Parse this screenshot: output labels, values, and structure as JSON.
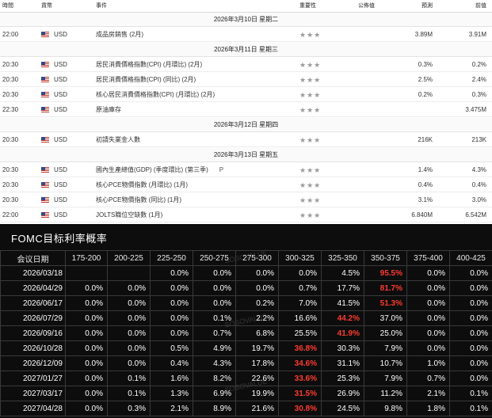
{
  "calendar": {
    "headers": {
      "time": "時間",
      "currency": "貨幣",
      "event": "事件",
      "importance": "重要性",
      "actual": "公佈值",
      "forecast": "預測",
      "previous": "前值"
    },
    "days": [
      {
        "date": "2026年3月10日 星期二",
        "events": [
          {
            "time": "22:00",
            "currency": "USD",
            "event": "成品房銷售 (2月)",
            "stars": "★★★",
            "actual": "",
            "forecast": "3.89M",
            "previous": "3.91M"
          }
        ]
      },
      {
        "date": "2026年3月11日 星期三",
        "events": [
          {
            "time": "20:30",
            "currency": "USD",
            "event": "居民消費價格指數(CPI) (月環比) (2月)",
            "stars": "★★★",
            "actual": "",
            "forecast": "0.3%",
            "previous": "0.2%"
          },
          {
            "time": "20:30",
            "currency": "USD",
            "event": "居民消費價格指數(CPI) (同比) (2月)",
            "stars": "★★★",
            "actual": "",
            "forecast": "2.5%",
            "previous": "2.4%"
          },
          {
            "time": "20:30",
            "currency": "USD",
            "event": "核心居民消費價格指數(CPI) (月環比) (2月)",
            "stars": "★★★",
            "actual": "",
            "forecast": "0.2%",
            "previous": "0.3%"
          },
          {
            "time": "22:30",
            "currency": "USD",
            "event": "原油庫存",
            "stars": "★★★",
            "actual": "",
            "forecast": "",
            "previous": "3.475M"
          }
        ]
      },
      {
        "date": "2026年3月12日 星期四",
        "events": [
          {
            "time": "20:30",
            "currency": "USD",
            "event": "初請失業金人數",
            "stars": "★★★",
            "actual": "",
            "forecast": "216K",
            "previous": "213K"
          }
        ]
      },
      {
        "date": "2026年3月13日 星期五",
        "events": [
          {
            "time": "20:30",
            "currency": "USD",
            "event": "國內生產總值(GDP) (季度環比) (第三季)",
            "extra": "P",
            "stars": "★★★",
            "actual": "",
            "forecast": "1.4%",
            "previous": "4.3%"
          },
          {
            "time": "20:30",
            "currency": "USD",
            "event": "核心PCE物價指數 (月環比) (1月)",
            "stars": "★★★",
            "actual": "",
            "forecast": "0.4%",
            "previous": "0.4%"
          },
          {
            "time": "20:30",
            "currency": "USD",
            "event": "核心PCE物價指數 (同比) (1月)",
            "stars": "★★★",
            "actual": "",
            "forecast": "3.1%",
            "previous": "3.0%"
          },
          {
            "time": "22:00",
            "currency": "USD",
            "event": "JOLTS職位空缺數 (1月)",
            "stars": "★★★",
            "actual": "",
            "forecast": "6.840M",
            "previous": "6.542M"
          }
        ]
      }
    ]
  },
  "fomc": {
    "title": "FOMC目标利率概率",
    "watermark": "SOSOVALUE",
    "highlight_color": "#ff3b30",
    "columns": [
      "会议日期",
      "175-200",
      "200-225",
      "225-250",
      "250-275",
      "275-300",
      "300-325",
      "325-350",
      "350-375",
      "375-400",
      "400-425"
    ],
    "rows": [
      {
        "date": "2026/03/18",
        "values": [
          "",
          "",
          "0.0%",
          "0.0%",
          "0.0%",
          "0.0%",
          "4.5%",
          "95.5%",
          "0.0%",
          "0.0%"
        ],
        "hot": 7
      },
      {
        "date": "2026/04/29",
        "values": [
          "0.0%",
          "0.0%",
          "0.0%",
          "0.0%",
          "0.0%",
          "0.7%",
          "17.7%",
          "81.7%",
          "0.0%",
          "0.0%"
        ],
        "hot": 7
      },
      {
        "date": "2026/06/17",
        "values": [
          "0.0%",
          "0.0%",
          "0.0%",
          "0.0%",
          "0.2%",
          "7.0%",
          "41.5%",
          "51.3%",
          "0.0%",
          "0.0%"
        ],
        "hot": 7
      },
      {
        "date": "2026/07/29",
        "values": [
          "0.0%",
          "0.0%",
          "0.0%",
          "0.1%",
          "2.2%",
          "16.6%",
          "44.2%",
          "37.0%",
          "0.0%",
          "0.0%"
        ],
        "hot": 6
      },
      {
        "date": "2026/09/16",
        "values": [
          "0.0%",
          "0.0%",
          "0.0%",
          "0.7%",
          "6.8%",
          "25.5%",
          "41.9%",
          "25.0%",
          "0.0%",
          "0.0%"
        ],
        "hot": 6
      },
      {
        "date": "2026/10/28",
        "values": [
          "0.0%",
          "0.0%",
          "0.5%",
          "4.9%",
          "19.7%",
          "36.8%",
          "30.3%",
          "7.9%",
          "0.0%",
          "0.0%"
        ],
        "hot": 5
      },
      {
        "date": "2026/12/09",
        "values": [
          "0.0%",
          "0.0%",
          "0.4%",
          "4.3%",
          "17.8%",
          "34.6%",
          "31.1%",
          "10.7%",
          "1.0%",
          "0.0%"
        ],
        "hot": 5
      },
      {
        "date": "2027/01/27",
        "values": [
          "0.0%",
          "0.1%",
          "1.6%",
          "8.2%",
          "22.6%",
          "33.6%",
          "25.3%",
          "7.9%",
          "0.7%",
          "0.0%"
        ],
        "hot": 5
      },
      {
        "date": "2027/03/17",
        "values": [
          "0.0%",
          "0.1%",
          "1.3%",
          "6.9%",
          "19.9%",
          "31.5%",
          "26.9%",
          "11.2%",
          "2.1%",
          "0.1%"
        ],
        "hot": 5
      },
      {
        "date": "2027/04/28",
        "values": [
          "0.0%",
          "0.3%",
          "2.1%",
          "8.9%",
          "21.6%",
          "30.8%",
          "24.5%",
          "9.8%",
          "1.8%",
          "0.1%"
        ],
        "hot": 5
      }
    ]
  }
}
